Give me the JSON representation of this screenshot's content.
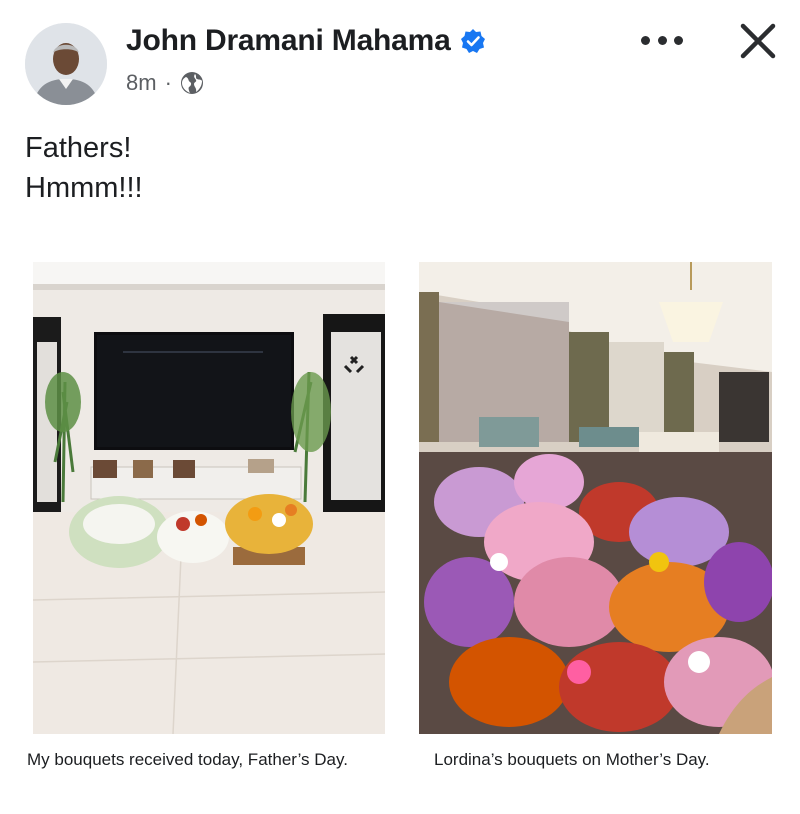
{
  "post": {
    "author": "John Dramani Mahama",
    "time": "8m",
    "separator": "·",
    "text_lines": [
      "Fathers!",
      "Hmmm!!!"
    ]
  },
  "icons": {
    "verified": "verified-badge-icon",
    "privacy": "globe-icon",
    "more": "more-options-icon",
    "close": "close-icon"
  },
  "colors": {
    "verified": "#1877f2"
  },
  "photos": [
    {
      "caption": "My bouquets received today, Father’s Day."
    },
    {
      "caption": "Lordina’s bouquets on Mother’s Day."
    }
  ]
}
